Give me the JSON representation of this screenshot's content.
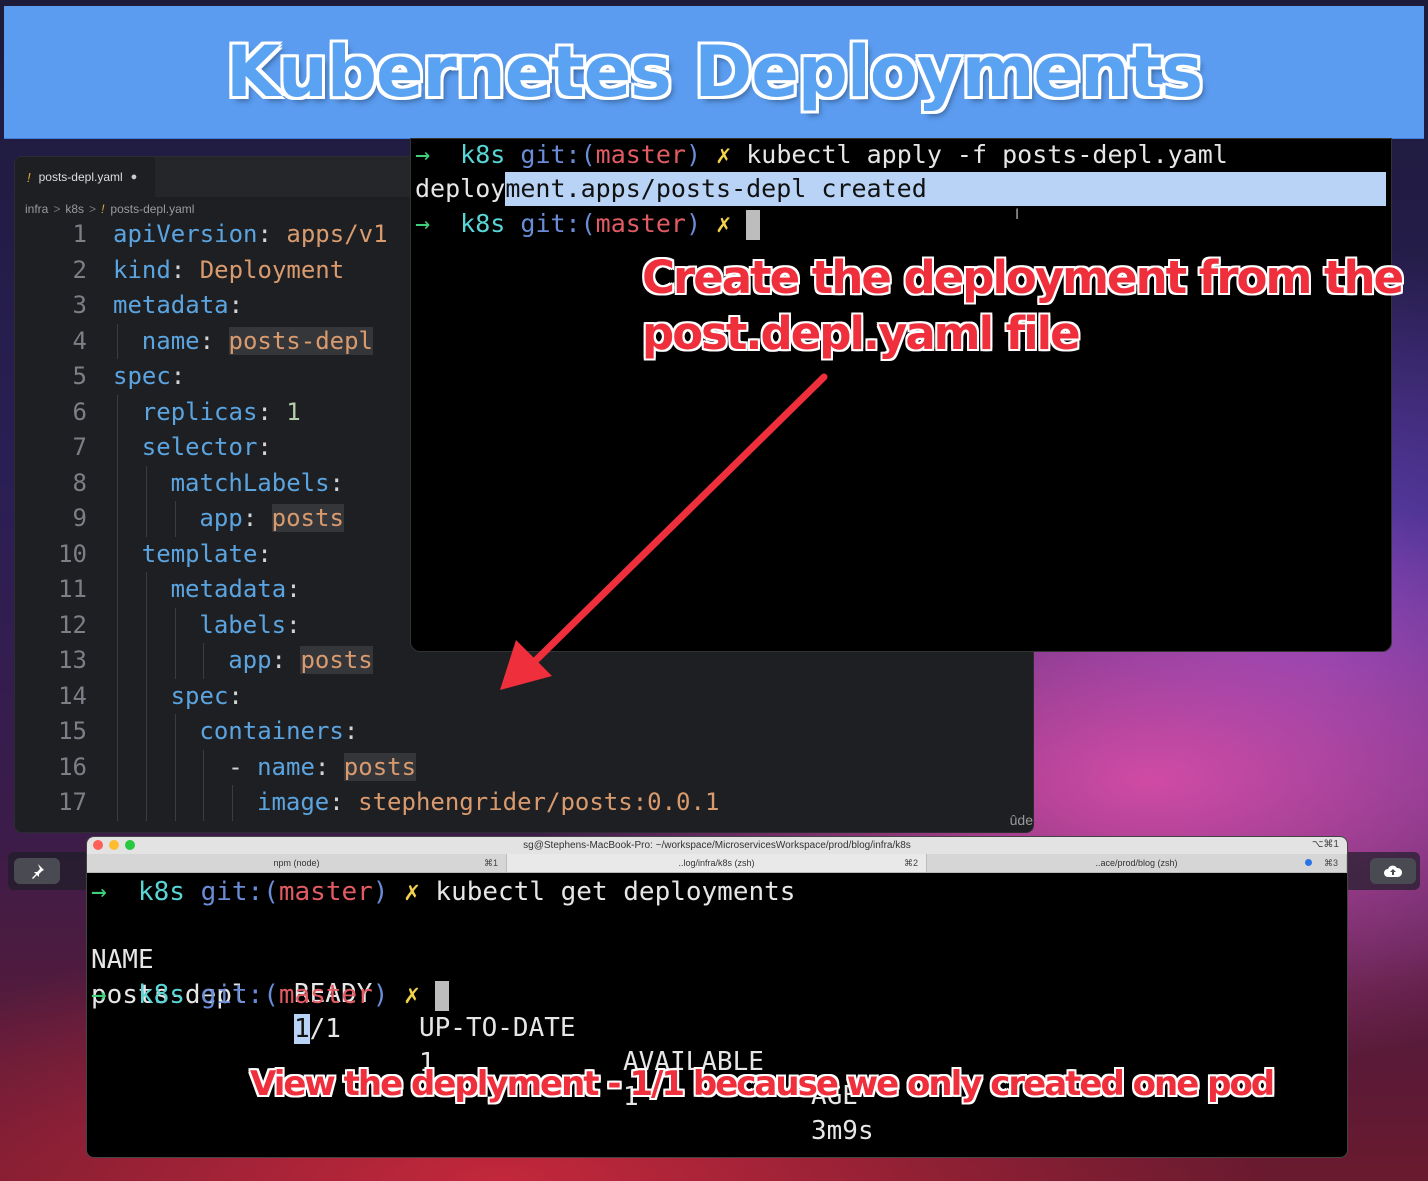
{
  "banner": {
    "title": "Kubernetes Deployments"
  },
  "editor": {
    "tab_label": "posts-depl.yaml",
    "breadcrumb": [
      "infra",
      "k8s",
      "posts-depl.yaml"
    ],
    "watermark": "ûde",
    "lines": [
      {
        "n": "1",
        "indent": 0,
        "key": "apiVersion",
        "sep": ": ",
        "val": "apps/v1"
      },
      {
        "n": "2",
        "indent": 0,
        "key": "kind",
        "sep": ": ",
        "val": "Deployment"
      },
      {
        "n": "3",
        "indent": 0,
        "key": "metadata",
        "sep": ":",
        "val": ""
      },
      {
        "n": "4",
        "indent": 1,
        "key": "name",
        "sep": ": ",
        "val": "posts-depl",
        "hl": true
      },
      {
        "n": "5",
        "indent": 0,
        "key": "spec",
        "sep": ":",
        "val": ""
      },
      {
        "n": "6",
        "indent": 1,
        "key": "replicas",
        "sep": ": ",
        "val": "1",
        "num": true
      },
      {
        "n": "7",
        "indent": 1,
        "key": "selector",
        "sep": ":",
        "val": ""
      },
      {
        "n": "8",
        "indent": 2,
        "key": "matchLabels",
        "sep": ":",
        "val": ""
      },
      {
        "n": "9",
        "indent": 3,
        "key": "app",
        "sep": ": ",
        "val": "posts",
        "hl": true
      },
      {
        "n": "10",
        "indent": 1,
        "key": "template",
        "sep": ":",
        "val": ""
      },
      {
        "n": "11",
        "indent": 2,
        "key": "metadata",
        "sep": ":",
        "val": ""
      },
      {
        "n": "12",
        "indent": 3,
        "key": "labels",
        "sep": ":",
        "val": ""
      },
      {
        "n": "13",
        "indent": 4,
        "key": "app",
        "sep": ": ",
        "val": "posts",
        "hl": true
      },
      {
        "n": "14",
        "indent": 2,
        "key": "spec",
        "sep": ":",
        "val": ""
      },
      {
        "n": "15",
        "indent": 3,
        "key": "containers",
        "sep": ":",
        "val": ""
      },
      {
        "n": "16",
        "indent": 4,
        "key": "name",
        "sep": ": ",
        "val": "posts",
        "dash": true,
        "hl": true
      },
      {
        "n": "17",
        "indent": 5,
        "key": "image",
        "sep": ": ",
        "val": "stephengrider/posts:0.0.1"
      }
    ]
  },
  "terminal_top": {
    "prompt_arrow": "→",
    "prompt_dir": "k8s",
    "prompt_git": "git:(",
    "prompt_branch": "master",
    "prompt_git_close": ")",
    "prompt_x": "✗",
    "command": "kubectl apply -f posts-depl.yaml",
    "output_plain": "deploy",
    "output_selected": "ment.apps/posts-depl created"
  },
  "annotation_top": {
    "line1": "Create the deployment from the",
    "line2": "post.depl.yaml file"
  },
  "annotation_bottom": {
    "text": "View the deplyment - 1/1 because we only created one pod"
  },
  "terminal_bottom": {
    "window_title": "sg@Stephens-MacBook-Pro: ~/workspace/MicroservicesWorkspace/prod/blog/infra/k8s",
    "shortcut": "⌥⌘1",
    "tabs": [
      {
        "label": "npm (node)",
        "key": "⌘1"
      },
      {
        "label": "..log/infra/k8s (zsh)",
        "key": "⌘2"
      },
      {
        "label": "..ace/prod/blog (zsh)",
        "key": "⌘3"
      }
    ],
    "command": "kubectl get deployments",
    "headers": [
      "NAME",
      "READY",
      "UP-TO-DATE",
      "AVAILABLE",
      "AGE"
    ],
    "row": {
      "name": "posts-depl",
      "ready_sel": "1",
      "ready_rest": "/1",
      "uptodate": "1",
      "available": "1",
      "age": "3m9s"
    }
  },
  "colors": {
    "annotation": "#ef2f3c",
    "banner": "#5b9cf0"
  }
}
